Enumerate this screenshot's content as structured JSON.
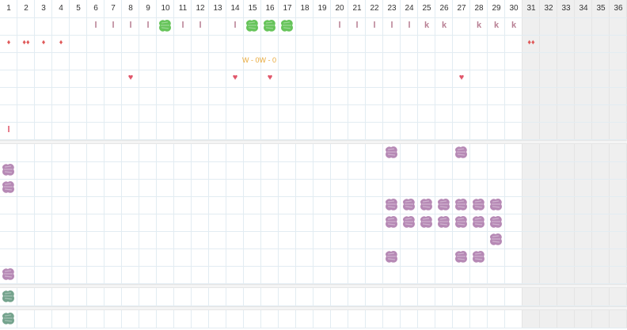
{
  "days": [
    "1",
    "2",
    "3",
    "4",
    "5",
    "6",
    "7",
    "8",
    "9",
    "10",
    "11",
    "12",
    "13",
    "14",
    "15",
    "16",
    "17",
    "18",
    "19",
    "20",
    "21",
    "22",
    "23",
    "24",
    "25",
    "26",
    "27",
    "28",
    "29",
    "30",
    "31",
    "32",
    "33",
    "34",
    "35",
    "36"
  ],
  "disabled_from_day": 31,
  "colors": {
    "green": "#66c45a",
    "purple": "#b689b5",
    "teal": "#74a38d",
    "drop": "#e05a5a",
    "heart": "#e0566a",
    "text_mark": "#b87f93",
    "wo": "#e8a93a"
  },
  "rows": [
    {
      "row": 1,
      "marks": [
        {
          "day": 6,
          "type": "text",
          "text": "l"
        },
        {
          "day": 7,
          "type": "text",
          "text": "l"
        },
        {
          "day": 8,
          "type": "text",
          "text": "l"
        },
        {
          "day": 9,
          "type": "text",
          "text": "l"
        },
        {
          "day": 10,
          "type": "blob",
          "color": "green",
          "icon": "chart-scribble-icon"
        },
        {
          "day": 11,
          "type": "text",
          "text": "l"
        },
        {
          "day": 12,
          "type": "text",
          "text": "l"
        },
        {
          "day": 14,
          "type": "text",
          "text": "l"
        },
        {
          "day": 15,
          "type": "blob",
          "color": "green",
          "icon": "chart-scribble-icon"
        },
        {
          "day": 16,
          "type": "blob",
          "color": "green",
          "icon": "chart-scribble-icon"
        },
        {
          "day": 17,
          "type": "blob",
          "color": "green",
          "icon": "chart-scribble-icon"
        },
        {
          "day": 20,
          "type": "text",
          "text": "l"
        },
        {
          "day": 21,
          "type": "text",
          "text": "l"
        },
        {
          "day": 22,
          "type": "text",
          "text": "l"
        },
        {
          "day": 23,
          "type": "text",
          "text": "l"
        },
        {
          "day": 24,
          "type": "text",
          "text": "l"
        },
        {
          "day": 25,
          "type": "text",
          "text": "k"
        },
        {
          "day": 26,
          "type": "text",
          "text": "k"
        },
        {
          "day": 28,
          "type": "text",
          "text": "k"
        },
        {
          "day": 29,
          "type": "text",
          "text": "k"
        },
        {
          "day": 30,
          "type": "text",
          "text": "k"
        }
      ]
    },
    {
      "row": 2,
      "marks": [
        {
          "day": 1,
          "type": "drop",
          "text": "♦"
        },
        {
          "day": 2,
          "type": "drop",
          "text": "♦♦"
        },
        {
          "day": 3,
          "type": "drop",
          "text": "♦"
        },
        {
          "day": 4,
          "type": "drop",
          "text": "♦"
        },
        {
          "day": 31,
          "type": "drop",
          "text": "♦♦"
        }
      ]
    },
    {
      "row": 3,
      "marks": [
        {
          "day": 15.5,
          "type": "wo",
          "text": "W - 0W - 0"
        }
      ]
    },
    {
      "row": 4,
      "marks": [
        {
          "day": 8,
          "type": "heart",
          "text": "♥"
        },
        {
          "day": 14,
          "type": "heart",
          "text": "♥"
        },
        {
          "day": 16,
          "type": "heart",
          "text": "♥"
        },
        {
          "day": 27,
          "type": "heart",
          "text": "♥"
        }
      ]
    },
    {
      "row": 5,
      "marks": []
    },
    {
      "row": 6,
      "marks": [
        {
          "day": 1,
          "type": "tick",
          "text": "l"
        }
      ]
    },
    {
      "row": 7,
      "marks": [
        {
          "day": 23,
          "type": "blob",
          "color": "purple",
          "icon": "scribble-icon"
        },
        {
          "day": 27,
          "type": "blob",
          "color": "purple",
          "icon": "scribble-icon"
        }
      ]
    },
    {
      "row": 8,
      "marks": [
        {
          "day": 1,
          "type": "blob",
          "color": "purple",
          "icon": "scribble-icon"
        }
      ]
    },
    {
      "row": 9,
      "marks": [
        {
          "day": 1,
          "type": "blob",
          "color": "purple",
          "icon": "scribble-icon"
        }
      ]
    },
    {
      "row": 10,
      "marks": [
        {
          "day": 23,
          "type": "blob",
          "color": "purple",
          "icon": "scribble-icon"
        },
        {
          "day": 24,
          "type": "blob",
          "color": "purple",
          "icon": "scribble-icon"
        },
        {
          "day": 25,
          "type": "blob",
          "color": "purple",
          "icon": "scribble-icon"
        },
        {
          "day": 26,
          "type": "blob",
          "color": "purple",
          "icon": "scribble-icon"
        },
        {
          "day": 27,
          "type": "blob",
          "color": "purple",
          "icon": "scribble-icon"
        },
        {
          "day": 28,
          "type": "blob",
          "color": "purple",
          "icon": "scribble-icon"
        },
        {
          "day": 29,
          "type": "blob",
          "color": "purple",
          "icon": "scribble-icon"
        }
      ]
    },
    {
      "row": 11,
      "marks": [
        {
          "day": 23,
          "type": "blob",
          "color": "purple",
          "icon": "scribble-icon"
        },
        {
          "day": 24,
          "type": "blob",
          "color": "purple",
          "icon": "scribble-icon"
        },
        {
          "day": 25,
          "type": "blob",
          "color": "purple",
          "icon": "scribble-icon"
        },
        {
          "day": 26,
          "type": "blob",
          "color": "purple",
          "icon": "scribble-icon"
        },
        {
          "day": 27,
          "type": "blob",
          "color": "purple",
          "icon": "scribble-icon"
        },
        {
          "day": 28,
          "type": "blob",
          "color": "purple",
          "icon": "scribble-icon"
        },
        {
          "day": 29,
          "type": "blob",
          "color": "purple",
          "icon": "scribble-icon"
        }
      ]
    },
    {
      "row": 12,
      "marks": [
        {
          "day": 29,
          "type": "blob",
          "color": "purple",
          "icon": "scribble-icon"
        }
      ]
    },
    {
      "row": 13,
      "marks": [
        {
          "day": 23,
          "type": "blob",
          "color": "purple",
          "icon": "scribble-icon"
        },
        {
          "day": 27,
          "type": "blob",
          "color": "purple",
          "icon": "scribble-icon"
        },
        {
          "day": 28,
          "type": "blob",
          "color": "purple",
          "icon": "scribble-icon"
        }
      ]
    },
    {
      "row": 14,
      "marks": [
        {
          "day": 1,
          "type": "blob",
          "color": "purple",
          "icon": "scribble-icon"
        }
      ]
    },
    {
      "row": 15,
      "marks": [
        {
          "day": 1,
          "type": "blob",
          "color": "teal",
          "icon": "scribble-icon"
        }
      ]
    },
    {
      "row": 16,
      "marks": [
        {
          "day": 1,
          "type": "blob",
          "color": "teal",
          "icon": "scribble-icon"
        }
      ]
    }
  ]
}
